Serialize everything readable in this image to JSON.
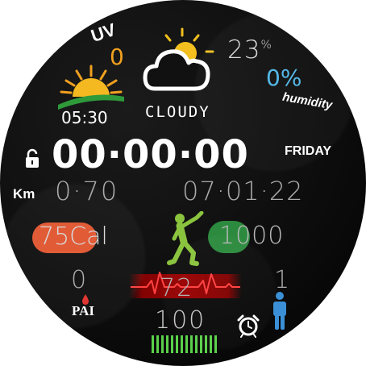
{
  "weather": {
    "uv_label": "UV",
    "uv_value": "0",
    "sunrise_time": "05:30",
    "condition": "CLOUDY",
    "temperature": "23",
    "temperature_unit": "%",
    "humidity_value": "0%",
    "humidity_label": "humidity"
  },
  "clock": {
    "time": "00·00·00",
    "weekday": "FRIDAY",
    "date": "07·01·22"
  },
  "activity": {
    "distance_unit": "Km",
    "distance": "0·70",
    "calories": "75Cal",
    "steps": "1000",
    "pai_value": "0",
    "pai_label": "PAI",
    "heart_rate": "72",
    "stand_count": "1",
    "battery": "100",
    "battery_level": 1.0
  },
  "icons": {
    "uv": "uv-text",
    "sunrise": "sunrise-icon",
    "weather": "cloud-sun-icon",
    "lock": "lock-icon",
    "exercise": "exercise-person-icon",
    "heart": "heart-icon",
    "heartbeat": "heartbeat-line-icon",
    "person": "person-icon",
    "alarm": "alarm-clock-icon",
    "battery": "battery-bars-icon"
  },
  "colors": {
    "uv_value": "#f0a020",
    "humidity": "#4fb6e6",
    "calories_pill": "#e05530",
    "steps_pill": "#2c8a3e",
    "exercise": "#8ac43e",
    "person": "#3a8fd6",
    "battery": "#5ad04a",
    "heart": "#e0302a"
  }
}
